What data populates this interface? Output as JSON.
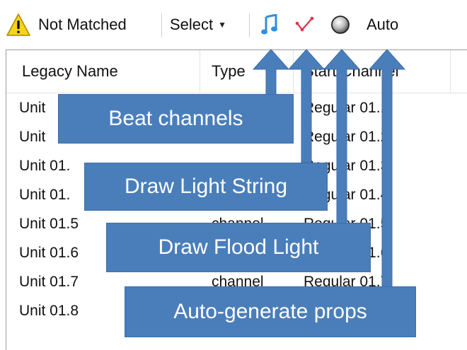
{
  "toolbar": {
    "status_label": "Not Matched",
    "select_label": "Select",
    "auto_label": "Auto",
    "icons": [
      "warning-icon",
      "music-note-icon",
      "light-string-icon",
      "flood-light-icon"
    ]
  },
  "table": {
    "headers": [
      "Legacy Name",
      "Type",
      "Start Channel"
    ],
    "rows": [
      {
        "name": "Unit",
        "type": "",
        "start": "Regular 01.1"
      },
      {
        "name": "Unit",
        "type": "",
        "start": "Regular 01.2"
      },
      {
        "name": "Unit 01.",
        "type": "",
        "start": "Regular 01.3"
      },
      {
        "name": "Unit 01.",
        "type": "",
        "start": "Regular 01.4"
      },
      {
        "name": "Unit 01.5",
        "type": "channel",
        "start": "Regular 01.5"
      },
      {
        "name": "Unit 01.6",
        "type": "",
        "start": "Regular 01.6"
      },
      {
        "name": "Unit 01.7",
        "type": "channel",
        "start": "Regular 01.7"
      },
      {
        "name": "Unit 01.8",
        "type": "",
        "start": ""
      }
    ]
  },
  "callouts": {
    "beat": "Beat channels",
    "string": "Draw Light String",
    "flood": "Draw Flood Light",
    "auto": "Auto-generate props"
  },
  "colors": {
    "callout_fill": "#4a7ebb",
    "note_blue": "#2f8fe0",
    "string_red": "#e0304a",
    "warning_yellow": "#f5d515"
  }
}
